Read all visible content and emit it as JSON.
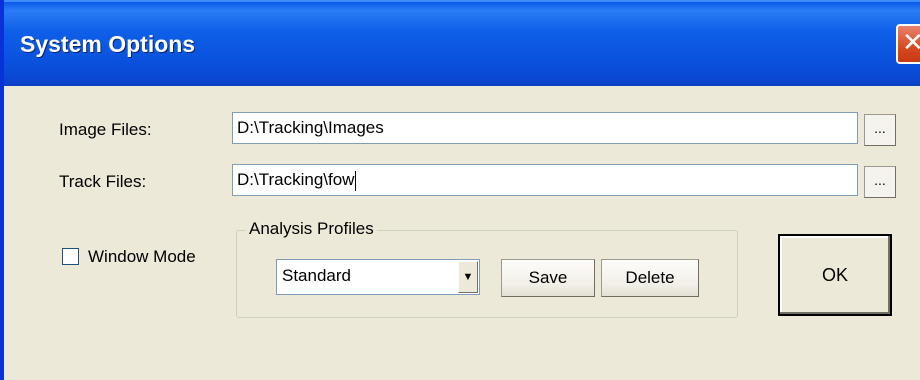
{
  "window": {
    "title": "System Options",
    "close_glyph": "✕"
  },
  "paths": {
    "image_files_label": "Image Files:",
    "image_files_value": "D:\\Tracking\\Images",
    "track_files_label": "Track Files:",
    "track_files_value": "D:\\Tracking\\fow",
    "browse_label": "..."
  },
  "window_mode": {
    "label": "Window Mode",
    "checked": false
  },
  "analysis_profiles": {
    "group_title": "Analysis Profiles",
    "selected_profile": "Standard",
    "dropdown_arrow": "▼",
    "save_label": "Save",
    "delete_label": "Delete"
  },
  "actions": {
    "ok_label": "OK"
  },
  "colors": {
    "titlebar": "#0a52de",
    "dialog_bg": "#ece9d8",
    "close_button": "#d7491f"
  }
}
